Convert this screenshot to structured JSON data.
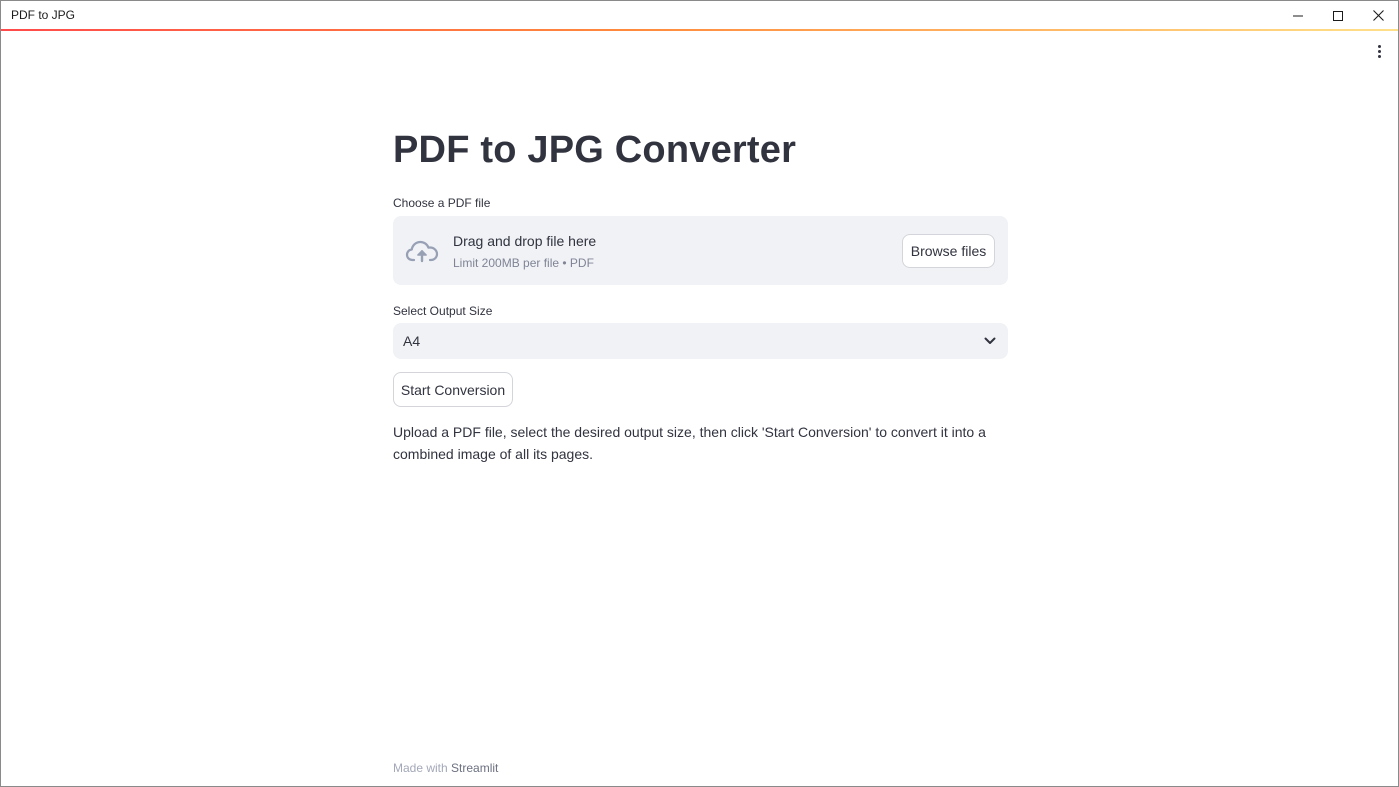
{
  "window": {
    "title": "PDF to JPG",
    "controls": {
      "minimize": "minimize-icon",
      "maximize": "maximize-icon",
      "close": "close-icon"
    }
  },
  "header": {
    "menu_icon": "kebab-menu-icon",
    "decoration_colors": [
      "#ff4b4b",
      "#ffe08a"
    ]
  },
  "main": {
    "title": "PDF to JPG Converter",
    "uploader": {
      "label": "Choose a PDF file",
      "drop_text": "Drag and drop file here",
      "limit_text": "Limit 200MB per file • PDF",
      "browse_label": "Browse files",
      "icon": "cloud-upload-icon"
    },
    "size_select": {
      "label": "Select Output Size",
      "selected": "A4"
    },
    "start_button": "Start Conversion",
    "description": "Upload a PDF file, select the desired output size, then click 'Start Conversion' to convert it into a combined image of all its pages."
  },
  "footer": {
    "prefix": "Made with",
    "brand": "Streamlit"
  },
  "colors": {
    "surface": "#f0f2f6",
    "text": "#31333f",
    "muted": "#808495"
  }
}
